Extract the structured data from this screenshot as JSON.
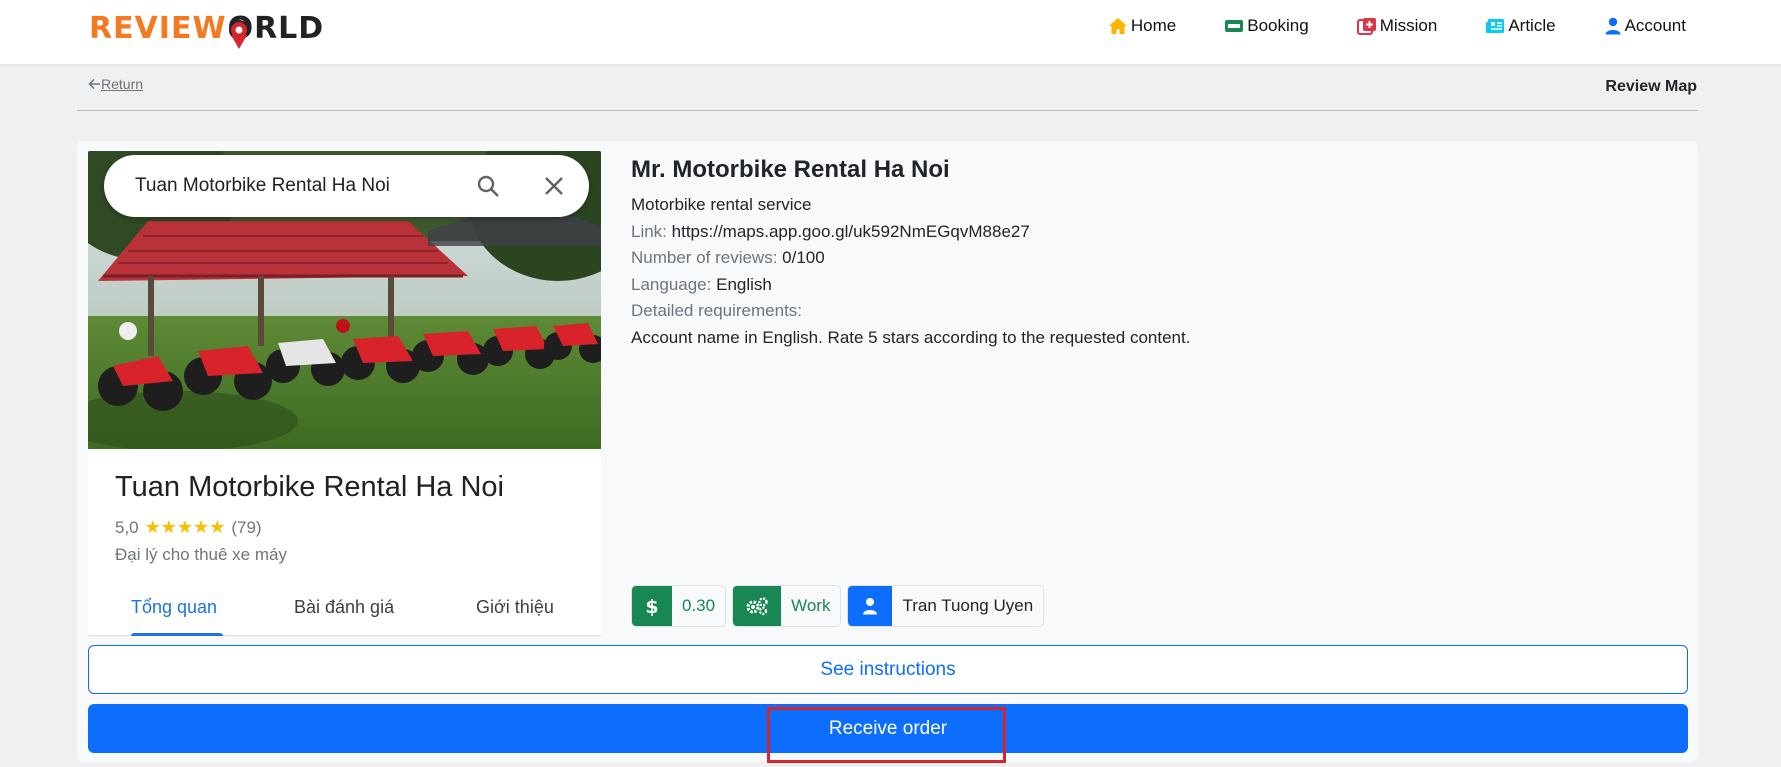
{
  "header": {
    "logo_left": "REVIEW",
    "logo_right": "RLD",
    "nav": [
      {
        "label": "Home",
        "icon": "home-icon",
        "color": "#ffb400"
      },
      {
        "label": "Booking",
        "icon": "ticket-icon",
        "color": "#198754"
      },
      {
        "label": "Mission",
        "icon": "mission-icon",
        "color": "#dc3545"
      },
      {
        "label": "Article",
        "icon": "newspaper-icon",
        "color": "#0dcaf0"
      },
      {
        "label": "Account",
        "icon": "user-icon",
        "color": "#0d6efd"
      }
    ]
  },
  "subheader": {
    "return_label": "Return",
    "page_label": "Review Map"
  },
  "preview": {
    "search_query": "Tuan Motorbike Rental Ha Noi",
    "place_name": "Tuan Motorbike Rental Ha Noi",
    "rating": "5,0",
    "stars": "★★★★★",
    "review_count": "(79)",
    "category": "Đại lý cho thuê xe máy",
    "tabs": [
      "Tổng quan",
      "Bài đánh giá",
      "Giới thiệu"
    ]
  },
  "details": {
    "title": "Mr. Motorbike Rental Ha Noi",
    "subtitle": "Motorbike rental service",
    "link_label": "Link:",
    "link_value": "https://maps.app.goo.gl/uk592NmEGqvM88e27",
    "reviews_label": "Number of reviews:",
    "reviews_value": "0/100",
    "language_label": "Language:",
    "language_value": "English",
    "requirements_label": "Detailed requirements:",
    "requirements_value": "Account name in English. Rate 5 stars according to the requested content."
  },
  "chips": {
    "price": "0.30",
    "status": "Work",
    "owner": "Tran Tuong Uyen"
  },
  "buttons": {
    "instructions": "See instructions",
    "receive": "Receive order"
  },
  "colors": {
    "primary": "#0d6efd",
    "success": "#198754",
    "highlight": "#d6262b",
    "logo_orange": "#f47a21"
  }
}
